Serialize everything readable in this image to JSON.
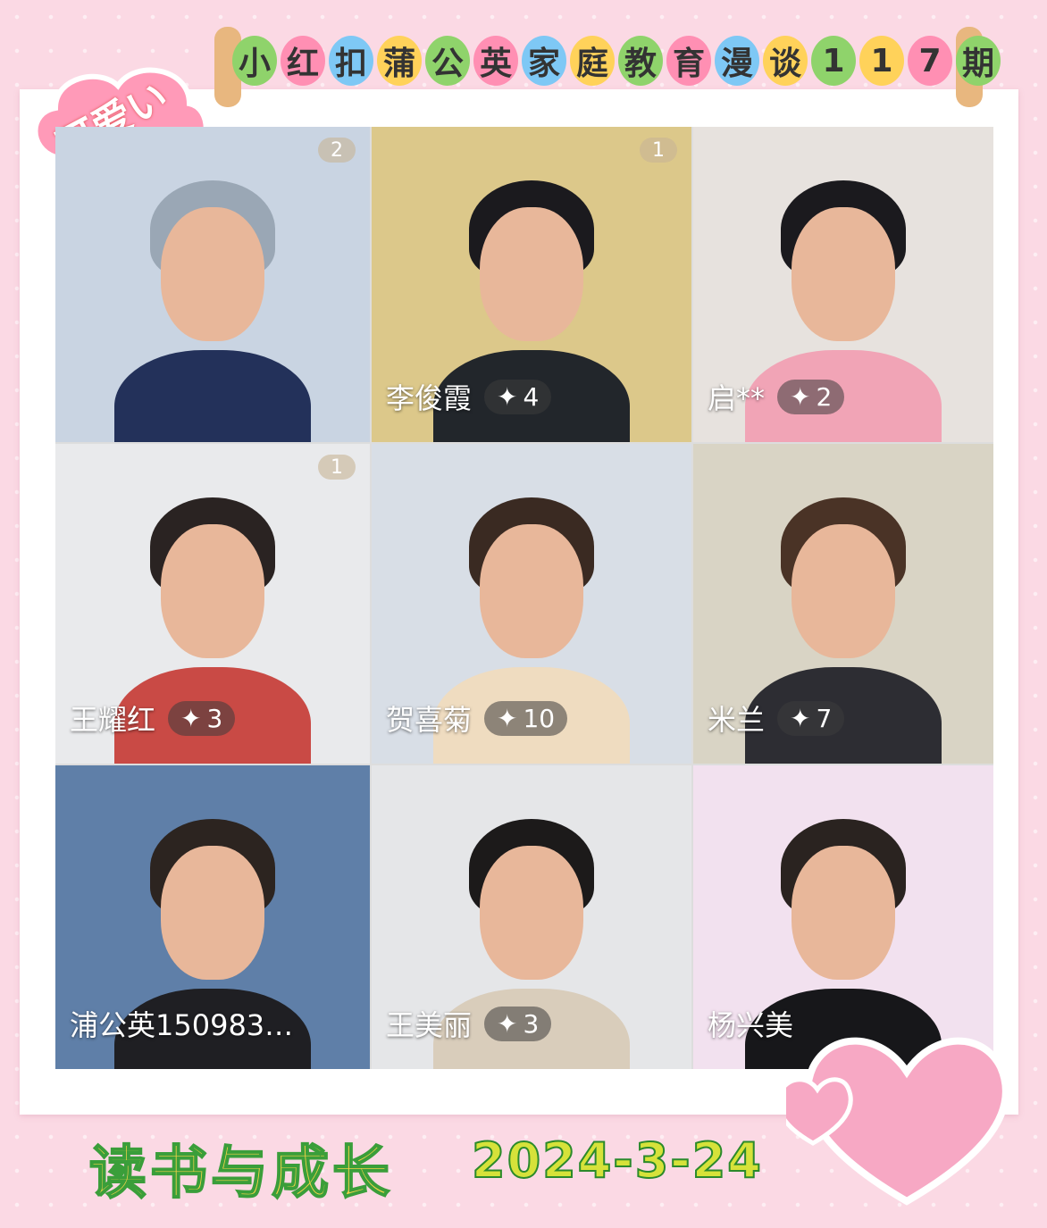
{
  "header": {
    "title_chars": [
      "小",
      "红",
      "扣",
      "蒲",
      "公",
      "英",
      "家",
      "庭",
      "教",
      "育",
      "漫",
      "谈",
      "1",
      "1",
      "7",
      "期"
    ],
    "bubble_colors": [
      "#8fd36b",
      "#ff8fb3",
      "#7ec8f5",
      "#ffd25a",
      "#8fd36b",
      "#ff8fb3",
      "#7ec8f5",
      "#ffd25a",
      "#8fd36b",
      "#ff8fb3",
      "#7ec8f5",
      "#ffd25a",
      "#8fd36b",
      "#ffd25a",
      "#ff8fb3",
      "#8fd36b"
    ]
  },
  "sticker": {
    "text": "可爱い"
  },
  "footer": {
    "title": "读书与成长",
    "date": "2024-3-24"
  },
  "tiles": [
    {
      "name": "",
      "score": "",
      "badge": "2",
      "bg": "#c9d4e2",
      "body": "#23315a",
      "hair": "#9aa7b5"
    },
    {
      "name": "李俊霞",
      "score": "4",
      "badge": "1",
      "bg": "#dcc88a",
      "body": "#22262b",
      "hair": "#1b1a1e"
    },
    {
      "name": "启**",
      "score": "2",
      "badge": "",
      "bg": "#e7e2de",
      "body": "#f1a4b6",
      "hair": "#1b1a1e"
    },
    {
      "name": "王耀红",
      "score": "3",
      "badge": "1",
      "bg": "#e9eaec",
      "body": "#c94a45",
      "hair": "#2a2322"
    },
    {
      "name": "贺喜菊",
      "score": "10",
      "badge": "",
      "bg": "#d8dee6",
      "body": "#efdcc0",
      "hair": "#3a2a22"
    },
    {
      "name": "米兰",
      "score": "7",
      "badge": "",
      "bg": "#d9d4c5",
      "body": "#2d2d33",
      "hair": "#4a3326"
    },
    {
      "name": "浦公英150983…",
      "score": "",
      "badge": "",
      "bg": "#5f7fa8",
      "body": "#1f1f23",
      "hair": "#2c2420"
    },
    {
      "name": "王美丽",
      "score": "3",
      "badge": "",
      "bg": "#e5e6e8",
      "body": "#d9cdbb",
      "hair": "#1c1a1a"
    },
    {
      "name": "杨兴美",
      "score": "",
      "badge": "",
      "bg": "#f2e1ef",
      "body": "#17171a",
      "hair": "#2a2320"
    }
  ]
}
